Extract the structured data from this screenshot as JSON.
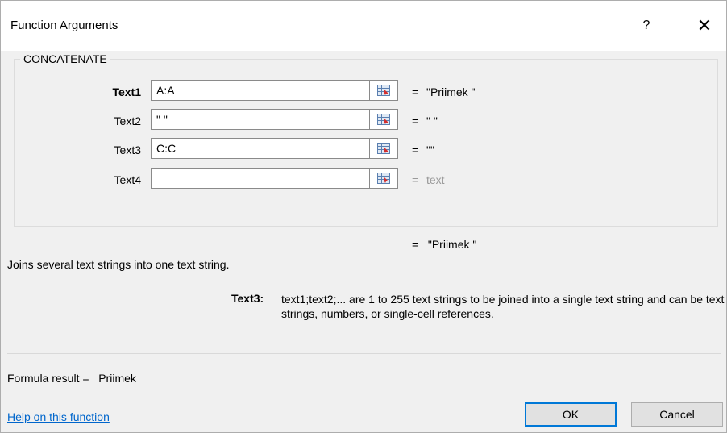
{
  "dialog": {
    "title": "Function Arguments",
    "help_label": "?",
    "close_label": "✕"
  },
  "function": {
    "name": "CONCATENATE",
    "args": [
      {
        "label": "Text1",
        "value": "A:A",
        "result": "\"Priimek \"",
        "bold": true
      },
      {
        "label": "Text2",
        "value": "\" \"",
        "result": "\" \"",
        "bold": false
      },
      {
        "label": "Text3",
        "value": "C:C",
        "result": "\"\"",
        "bold": false
      },
      {
        "label": "Text4",
        "value": "",
        "result": "text",
        "bold": false
      }
    ],
    "equals": "=",
    "overall_result": "\"Priimek \"",
    "description": "Joins several text strings into one text string.",
    "arg_desc_name": "Text3:",
    "arg_desc_text": "text1;text2;... are 1 to 255 text strings to be joined into a single text string and can be text strings, numbers, or single-cell references."
  },
  "footer": {
    "formula_result_label": "Formula result =",
    "formula_result_value": "Priimek",
    "help_link": "Help on this function",
    "ok_label": "OK",
    "cancel_label": "Cancel"
  },
  "icons": {
    "ref_button": "collapse-dialog-icon"
  },
  "colors": {
    "link": "#0066cc",
    "ok_border": "#0078d7",
    "placeholder_result": "#9a9a9a"
  }
}
